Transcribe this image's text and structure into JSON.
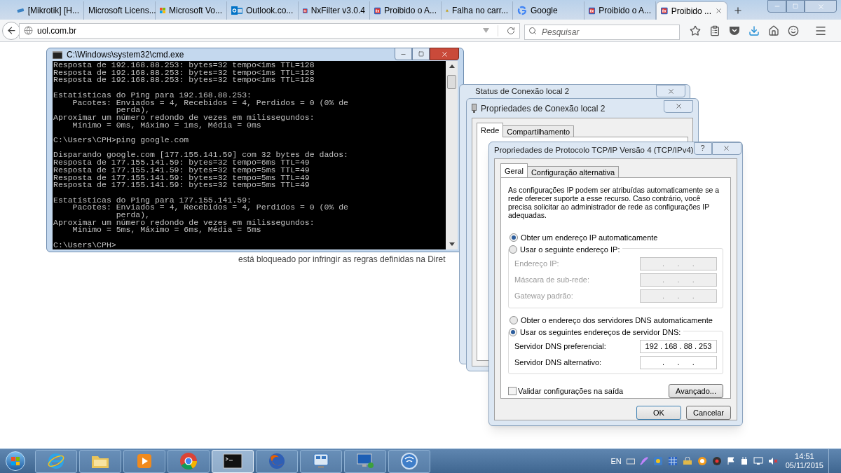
{
  "browser": {
    "tabs": [
      {
        "label": "[Mikrotik] [H...",
        "kind": "router",
        "selected": false
      },
      {
        "label": "Microsoft Licens...",
        "kind": "plain",
        "selected": false
      },
      {
        "label": "Microsoft Vo...",
        "kind": "tiles",
        "selected": false
      },
      {
        "label": "Outlook.co...",
        "kind": "mail",
        "selected": false
      },
      {
        "label": "NxFilter v3.0.4",
        "kind": "nx",
        "selected": false
      },
      {
        "label": "Proibido o A...",
        "kind": "nx",
        "selected": false
      },
      {
        "label": "Falha no carr...",
        "kind": "warning",
        "selected": false
      },
      {
        "label": "Google",
        "kind": "g",
        "selected": false
      },
      {
        "label": "Proibido o A...",
        "kind": "nx",
        "selected": false
      },
      {
        "label": "Proibido ...",
        "kind": "nx",
        "selected": true
      }
    ],
    "address": "uol.com.br",
    "search": {
      "placeholder": "Pesquisar"
    }
  },
  "page": {
    "text": "está bloqueado por infringir as regras definidas na Diret"
  },
  "cmd": {
    "title": "C:\\Windows\\system32\\cmd.exe",
    "blocks": [
      [
        "Resposta de 192.168.88.253: bytes=32 tempo<1ms TTL=128",
        "Resposta de 192.168.88.253: bytes=32 tempo<1ms TTL=128",
        "Resposta de 192.168.88.253: bytes=32 tempo<1ms TTL=128"
      ],
      [
        "Estatísticas do Ping para 192.168.88.253:",
        "    Pacotes: Enviados = 4, Recebidos = 4, Perdidos = 0 (0% de",
        "             perda),",
        "Aproximar um número redondo de vezes em milissegundos:",
        "    Mínimo = 0ms, Máximo = 1ms, Média = 0ms"
      ],
      [
        "C:\\Users\\CPH>ping google.com"
      ],
      [
        "Disparando google.com [177.155.141.59] com 32 bytes de dados:",
        "Resposta de 177.155.141.59: bytes=32 tempo=6ms TTL=49",
        "Resposta de 177.155.141.59: bytes=32 tempo=5ms TTL=49",
        "Resposta de 177.155.141.59: bytes=32 tempo=5ms TTL=49",
        "Resposta de 177.155.141.59: bytes=32 tempo=5ms TTL=49"
      ],
      [
        "Estatísticas do Ping para 177.155.141.59:",
        "    Pacotes: Enviados = 4, Recebidos = 4, Perdidos = 0 (0% de",
        "             perda),",
        "Aproximar um número redondo de vezes em milissegundos:",
        "    Mínimo = 5ms, Máximo = 6ms, Média = 5ms"
      ],
      [
        "C:\\Users\\CPH>"
      ]
    ]
  },
  "status_window": {
    "title": "Status de Conexão local 2"
  },
  "connection_props": {
    "title": "Propriedades de Conexão local 2",
    "tabs": [
      {
        "label": "Rede",
        "selected": true
      },
      {
        "label": "Compartilhamento",
        "selected": false
      }
    ]
  },
  "tcpip": {
    "title": "Propriedades de Protocolo TCP/IP Versão 4 (TCP/IPv4)",
    "help_button": "?",
    "tabs": [
      {
        "label": "Geral",
        "selected": true
      },
      {
        "label": "Configuração alternativa",
        "selected": false
      }
    ],
    "description": "As configurações IP podem ser atribuídas automaticamente se a rede oferecer suporte a esse recurso. Caso contrário, você precisa solicitar ao administrador de rede as configurações IP adequadas.",
    "ip_auto": {
      "label": "Obter um endereço IP automaticamente",
      "selected": true
    },
    "ip_manual": {
      "label": "Usar o seguinte endereço IP:",
      "selected": false
    },
    "ip_fields": [
      {
        "label": "Endereço IP:",
        "value": ".      .      .",
        "disabled": true
      },
      {
        "label": "Máscara de sub-rede:",
        "value": ".      .      .",
        "disabled": true
      },
      {
        "label": "Gateway padrão:",
        "value": ".      .      .",
        "disabled": true
      }
    ],
    "dns_auto": {
      "label": "Obter o endereço dos servidores DNS automaticamente",
      "selected": false
    },
    "dns_manual": {
      "label": "Usar os seguintes endereços de servidor DNS:",
      "selected": true
    },
    "dns_fields": [
      {
        "label": "Servidor DNS preferencial:",
        "value": "192 . 168 . 88 . 253",
        "disabled": false
      },
      {
        "label": "Servidor DNS alternativo:",
        "value": ".      .      .",
        "disabled": false
      }
    ],
    "validate": {
      "label": "Validar configurações na saída",
      "checked": false
    },
    "advanced_button": "Avançado...",
    "ok_button": "OK",
    "cancel_button": "Cancelar"
  },
  "taskbar": {
    "apps": [
      {
        "kind": "ie",
        "active": false
      },
      {
        "kind": "folder",
        "active": false
      },
      {
        "kind": "media",
        "active": false
      },
      {
        "kind": "chrome",
        "active": false
      },
      {
        "kind": "console",
        "active": true
      },
      {
        "kind": "firefox",
        "active": false
      },
      {
        "kind": "network",
        "active": false
      },
      {
        "kind": "monitor",
        "active": false
      },
      {
        "kind": "circle",
        "active": false
      }
    ],
    "language": "EN",
    "time": "14:51",
    "date": "05/11/2015"
  }
}
